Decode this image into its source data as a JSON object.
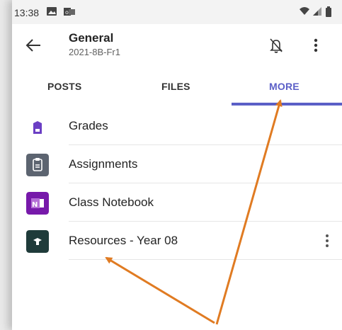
{
  "status_bar": {
    "time": "13:38"
  },
  "header": {
    "title": "General",
    "subtitle": "2021-8B-Fr1"
  },
  "tabs": [
    {
      "label": "POSTS",
      "active": false
    },
    {
      "label": "FILES",
      "active": false
    },
    {
      "label": "MORE",
      "active": true
    }
  ],
  "more_items": [
    {
      "label": "Grades",
      "icon": "grades-icon",
      "color": "#6b3fc4"
    },
    {
      "label": "Assignments",
      "icon": "assignments-icon",
      "color": "#5c6470"
    },
    {
      "label": "Class Notebook",
      "icon": "onenote-icon",
      "color": "#7719aa"
    },
    {
      "label": "Resources - Year 08",
      "icon": "resources-icon",
      "color": "#1f3b3a"
    }
  ],
  "colors": {
    "accent": "#5b5fc7",
    "annotation_arrow": "#e07b22"
  }
}
